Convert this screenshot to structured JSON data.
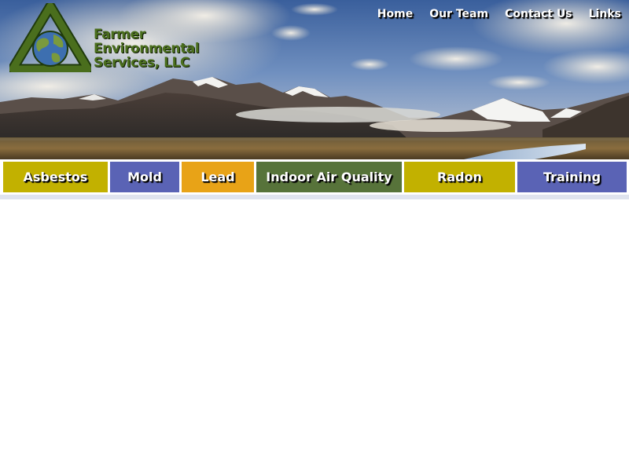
{
  "logo": {
    "line1": "Farmer",
    "line2": "Environmental",
    "line3": "Services, LLC"
  },
  "top_nav": {
    "items": [
      {
        "label": "Home"
      },
      {
        "label": "Our Team"
      },
      {
        "label": "Contact Us"
      },
      {
        "label": "Links"
      }
    ]
  },
  "categories": {
    "items": [
      {
        "label": "Asbestos",
        "color": "#c2b100"
      },
      {
        "label": "Mold",
        "color": "#5a63b5"
      },
      {
        "label": "Lead",
        "color": "#e8a317"
      },
      {
        "label": "Indoor Air Quality",
        "color": "#57733a"
      },
      {
        "label": "Radon",
        "color": "#c2b100"
      },
      {
        "label": "Training",
        "color": "#5a63b5"
      }
    ]
  },
  "colors": {
    "brand_green": "#4a6e1d",
    "strip": "#dfe3ee"
  }
}
